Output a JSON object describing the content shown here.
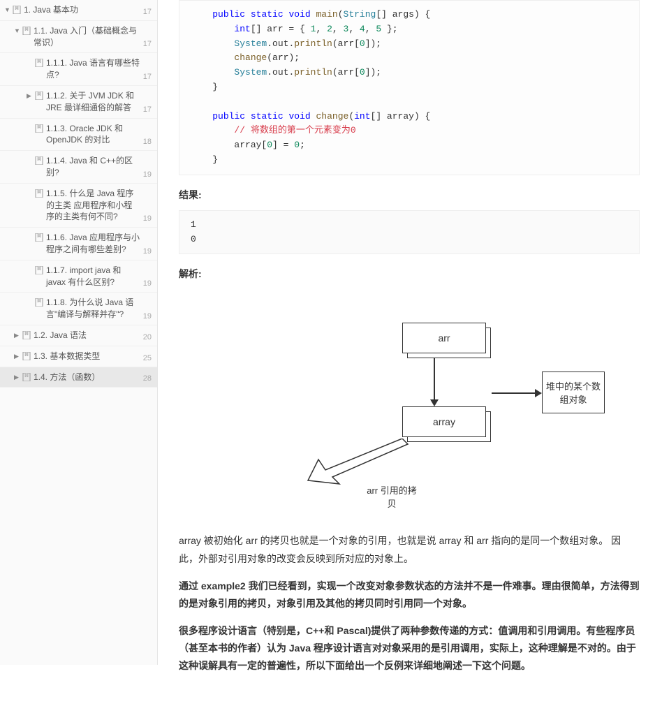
{
  "sidebar": {
    "items": [
      {
        "label": "1. Java 基本功",
        "page": "17",
        "level": 0,
        "arrow": "down",
        "active": false
      },
      {
        "label": "1.1. Java 入门（基础概念与常识）",
        "page": "17",
        "level": 1,
        "arrow": "down",
        "active": false
      },
      {
        "label": "1.1.1. Java 语言有哪些特点?",
        "page": "17",
        "level": 2,
        "arrow": "",
        "active": false
      },
      {
        "label": "1.1.2. 关于 JVM JDK 和 JRE 最详细通俗的解答",
        "page": "17",
        "level": 2,
        "arrow": "right",
        "active": false
      },
      {
        "label": "1.1.3. Oracle JDK 和 OpenJDK 的对比",
        "page": "18",
        "level": 2,
        "arrow": "",
        "active": false
      },
      {
        "label": "1.1.4. Java 和 C++的区别?",
        "page": "19",
        "level": 2,
        "arrow": "",
        "active": false
      },
      {
        "label": "1.1.5. 什么是 Java 程序的主类 应用程序和小程序的主类有何不同?",
        "page": "19",
        "level": 2,
        "arrow": "",
        "active": false
      },
      {
        "label": "1.1.6. Java 应用程序与小程序之间有哪些差别?",
        "page": "19",
        "level": 2,
        "arrow": "",
        "active": false
      },
      {
        "label": "1.1.7. import java 和 javax 有什么区别?",
        "page": "19",
        "level": 2,
        "arrow": "",
        "active": false
      },
      {
        "label": "1.1.8. 为什么说 Java 语言\"编译与解释并存\"?",
        "page": "19",
        "level": 2,
        "arrow": "",
        "active": false
      },
      {
        "label": "1.2. Java 语法",
        "page": "20",
        "level": 1,
        "arrow": "right",
        "active": false
      },
      {
        "label": "1.3. 基本数据类型",
        "page": "25",
        "level": 1,
        "arrow": "right",
        "active": false
      },
      {
        "label": "1.4. 方法（函数）",
        "page": "28",
        "level": 1,
        "arrow": "right",
        "active": true
      }
    ]
  },
  "code": {
    "line1_public": "public",
    "line1_static": "static",
    "line1_void": "void",
    "line1_main": "main",
    "line1_string": "String",
    "line1_args": "[] args) {",
    "line2_int": "int",
    "line2_arr": "[] arr = { ",
    "line2_n1": "1",
    "line2_n2": "2",
    "line2_n3": "3",
    "line2_n4": "4",
    "line2_n5": "5",
    "line2_end": " };",
    "line3_sys": "System",
    "line3_out": ".out.",
    "line3_println": "println",
    "line3_arg": "(arr[",
    "line3_zero": "0",
    "line3_end": "]);",
    "line4_change": "change",
    "line4_arg": "(arr);",
    "line5_sys": "System",
    "line5_out": ".out.",
    "line5_println": "println",
    "line5_arg": "(arr[",
    "line5_zero": "0",
    "line5_end": "]);",
    "line6_brace": "}",
    "line8_public": "public",
    "line8_static": "static",
    "line8_void": "void",
    "line8_change": "change",
    "line8_int": "int",
    "line8_args": "[] array) {",
    "line9_comment": "// 将数组的第一个元素变为0",
    "line10_array": "array[",
    "line10_zero1": "0",
    "line10_mid": "] = ",
    "line10_zero2": "0",
    "line10_end": ";",
    "line11_brace": "}"
  },
  "sections": {
    "result_title": "结果:",
    "result_output": "1\n0",
    "analysis_title": "解析:"
  },
  "diagram": {
    "box_arr": "arr",
    "box_array": "array",
    "box_heap": "堆中的某个数组对象",
    "label_copy": "arr 引用的拷贝"
  },
  "paragraphs": {
    "p1": "array 被初始化 arr 的拷贝也就是一个对象的引用，也就是说 array 和 arr 指向的是同一个数组对象。 因此，外部对引用对象的改变会反映到所对应的对象上。",
    "p2": "通过 example2 我们已经看到，实现一个改变对象参数状态的方法并不是一件难事。理由很简单，方法得到的是对象引用的拷贝，对象引用及其他的拷贝同时引用同一个对象。",
    "p3": "很多程序设计语言（特别是，C++和 Pascal)提供了两种参数传递的方式：值调用和引用调用。有些程序员（甚至本书的作者）认为 Java 程序设计语言对对象采用的是引用调用，实际上，这种理解是不对的。由于这种误解具有一定的普遍性，所以下面给出一个反例来详细地阐述一下这个问题。"
  }
}
